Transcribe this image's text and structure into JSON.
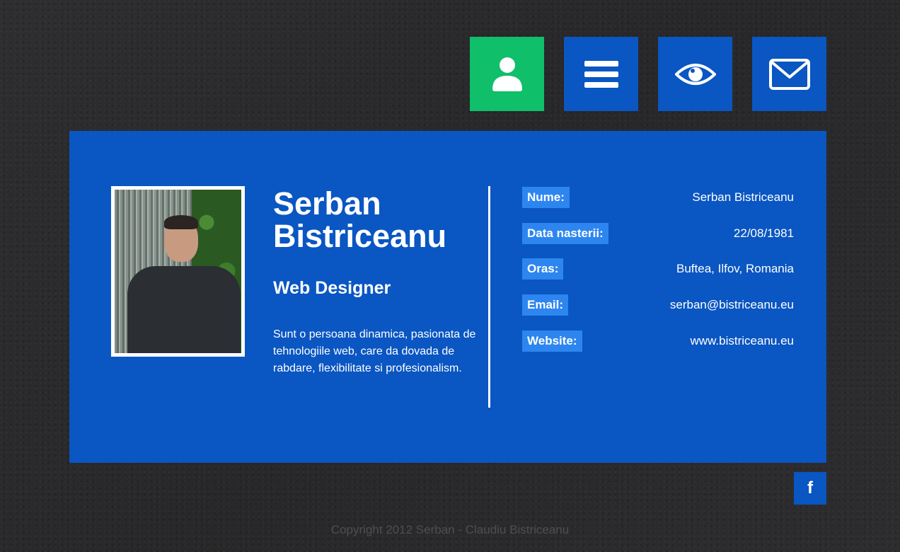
{
  "nav": [
    {
      "icon": "user-icon",
      "active": true
    },
    {
      "icon": "menu-icon",
      "active": false
    },
    {
      "icon": "eye-icon",
      "active": false
    },
    {
      "icon": "envelope-icon",
      "active": false
    }
  ],
  "colors": {
    "accent_blue": "#0a56c2",
    "active_green": "#0fbf6a",
    "label_blue": "#2d86ef",
    "background": "#2b2b2d"
  },
  "profile": {
    "name": "Serban Bistriceanu",
    "role": "Web Designer",
    "bio": "Sunt o persoana dinamica, pasionata de tehnologiile web, care da dovada de rabdare, flexibilitate si profesionalism."
  },
  "info": [
    {
      "label": "Nume:",
      "value": "Serban Bistriceanu"
    },
    {
      "label": "Data nasterii:",
      "value": "22/08/1981"
    },
    {
      "label": "Oras:",
      "value": "Buftea, Ilfov, Romania"
    },
    {
      "label": "Email:",
      "value": "serban@bistriceanu.eu"
    },
    {
      "label": "Website:",
      "value": "www.bistriceanu.eu"
    }
  ],
  "social": {
    "facebook_label": "f"
  },
  "footer": {
    "copyright": "Copyright 2012 Serban - Claudiu Bistriceanu"
  }
}
